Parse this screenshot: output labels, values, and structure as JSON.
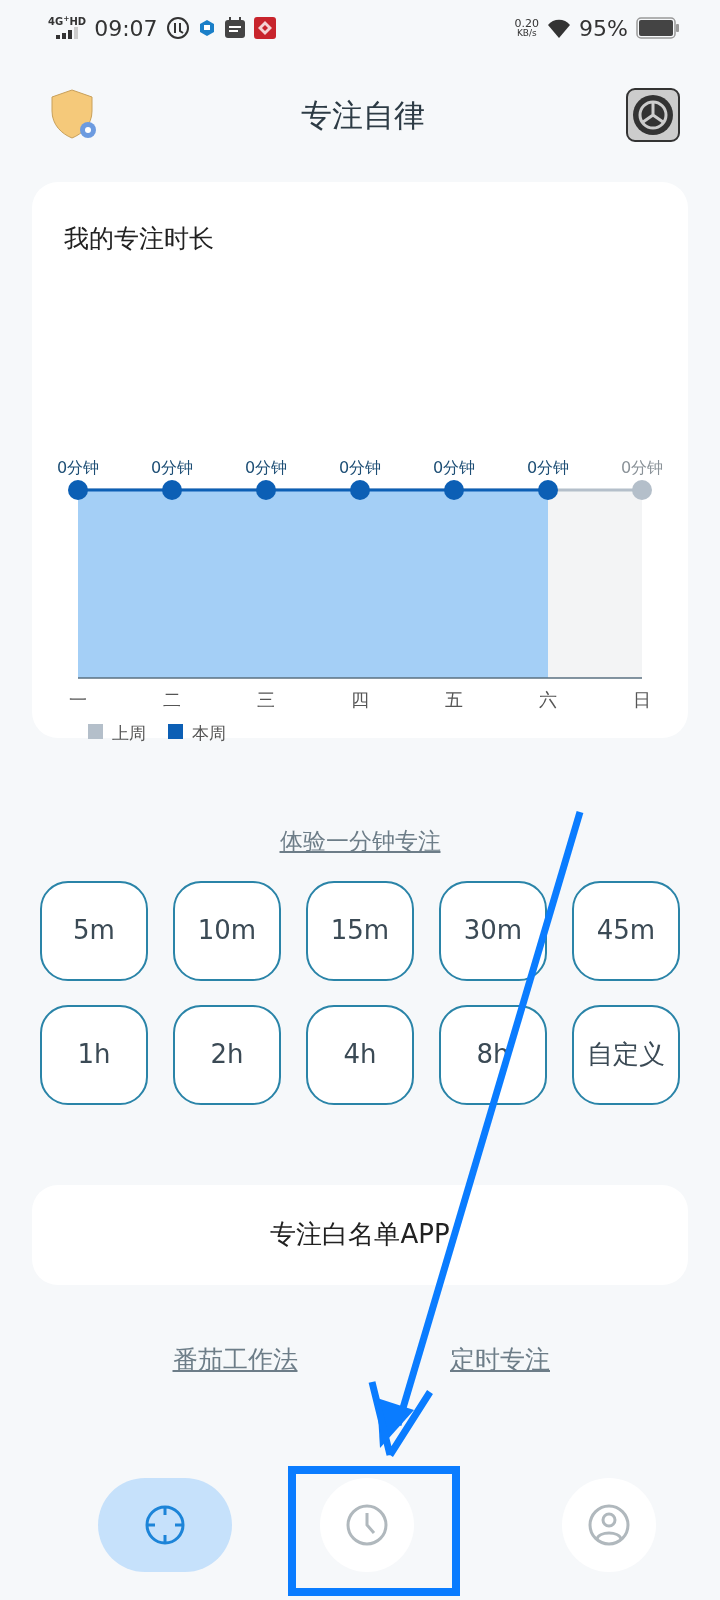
{
  "status_bar": {
    "network": "4G$^{+}$HD",
    "time": "09:07",
    "speed": "0.20",
    "speed_unit": "KB/s",
    "battery": "95%"
  },
  "header": {
    "title": "专注自律"
  },
  "focus_card": {
    "title": "我的专注时长",
    "days": [
      {
        "label": "一",
        "value": "0分钟",
        "this_week": true
      },
      {
        "label": "二",
        "value": "0分钟",
        "this_week": true
      },
      {
        "label": "三",
        "value": "0分钟",
        "this_week": true
      },
      {
        "label": "四",
        "value": "0分钟",
        "this_week": true
      },
      {
        "label": "五",
        "value": "0分钟",
        "this_week": true
      },
      {
        "label": "六",
        "value": "0分钟",
        "this_week": true
      },
      {
        "label": "日",
        "value": "0分钟",
        "this_week": false
      }
    ],
    "legend": [
      {
        "label": "上周",
        "color": "#b4bfca"
      },
      {
        "label": "本周",
        "color": "#0c5fb5"
      }
    ]
  },
  "trial_link": "体验一分钟专注",
  "durations": [
    "5m",
    "10m",
    "15m",
    "30m",
    "45m",
    "1h",
    "2h",
    "4h",
    "8h",
    "自定义"
  ],
  "whitelist_button": "专注白名单APP",
  "links": [
    "番茄工作法",
    "定时专注"
  ],
  "bottom_nav": [
    {
      "selected": true
    },
    {
      "selected": false
    },
    {
      "selected": false
    }
  ]
}
